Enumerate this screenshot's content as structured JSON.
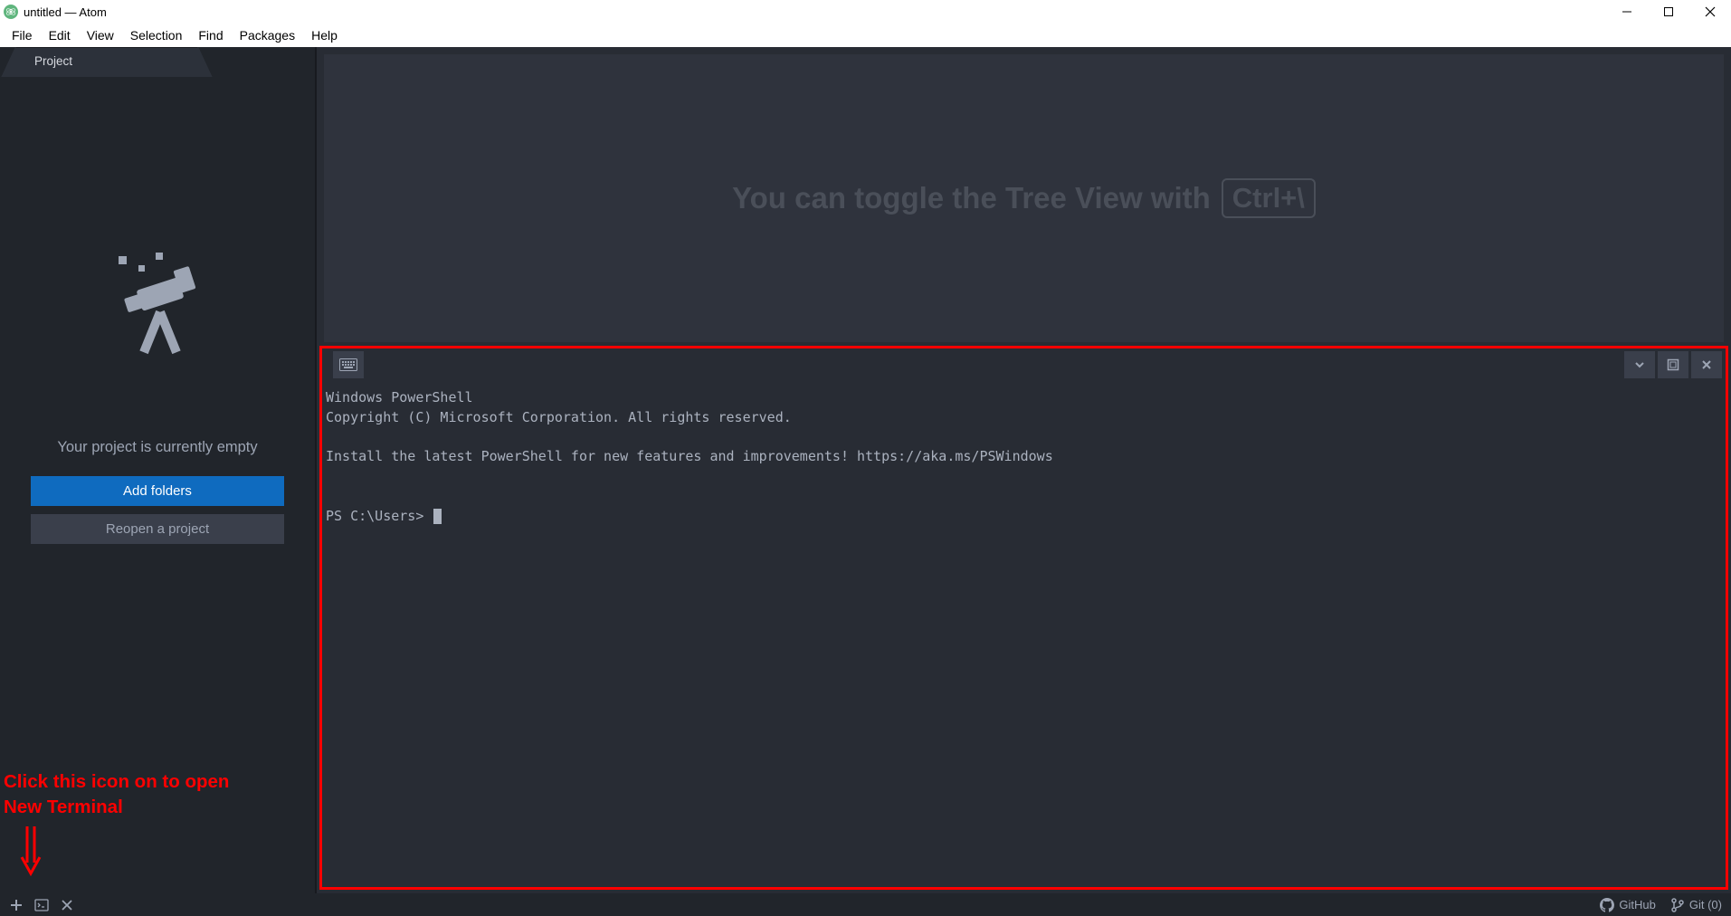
{
  "titlebar": {
    "title": "untitled — Atom"
  },
  "menu": {
    "file": "File",
    "edit": "Edit",
    "view": "View",
    "selection": "Selection",
    "find": "Find",
    "packages": "Packages",
    "help": "Help"
  },
  "sidebar": {
    "tab": "Project",
    "empty_text": "Your project is currently empty",
    "add_folders": "Add folders",
    "reopen": "Reopen a project"
  },
  "annotation": {
    "line1": "Click this icon on to open",
    "line2": "New Terminal"
  },
  "editor": {
    "hint_text": "You can toggle the Tree View with",
    "hint_kbd": "Ctrl+\\"
  },
  "terminal": {
    "line1": "Windows PowerShell",
    "line2": "Copyright (C) Microsoft Corporation. All rights reserved.",
    "line3": "",
    "line4": "Install the latest PowerShell for new features and improvements! https://aka.ms/PSWindows",
    "line5": "",
    "line6": "",
    "prompt": "PS C:\\Users> "
  },
  "statusbar": {
    "github": "GitHub",
    "git": "Git (0)"
  }
}
